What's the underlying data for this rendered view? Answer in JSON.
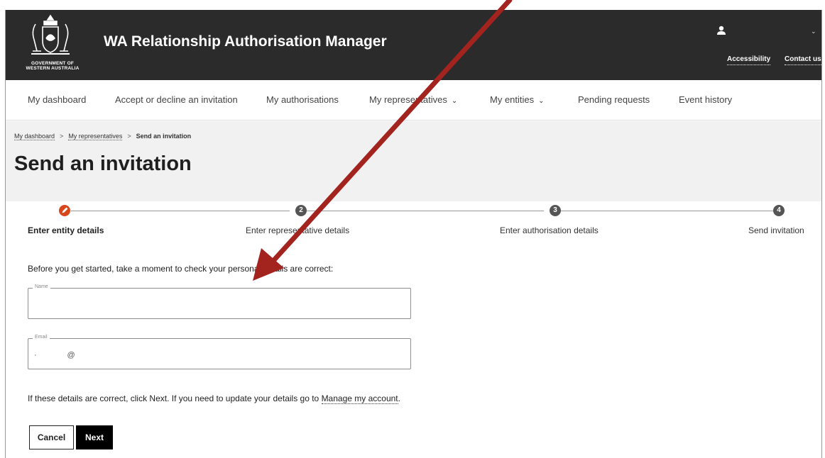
{
  "header": {
    "crest_text_line1": "GOVERNMENT OF",
    "crest_text_line2": "WESTERN AUSTRALIA",
    "app_title": "WA Relationship Authorisation Manager",
    "accessibility_link": "Accessibility",
    "contact_link": "Contact us"
  },
  "nav": {
    "items": [
      {
        "label": "My dashboard"
      },
      {
        "label": "Accept or decline an invitation"
      },
      {
        "label": "My authorisations"
      },
      {
        "label": "My representatives"
      },
      {
        "label": "My entities"
      },
      {
        "label": "Pending requests"
      },
      {
        "label": "Event history"
      }
    ]
  },
  "breadcrumb": {
    "item1": "My dashboard",
    "item2": "My representatives",
    "current": "Send an invitation",
    "separator": ">"
  },
  "page": {
    "title": "Send an invitation"
  },
  "stepper": {
    "steps": [
      {
        "number": "",
        "label": "Enter entity details",
        "state": "active"
      },
      {
        "number": "2",
        "label": "Enter representative details",
        "state": "pending"
      },
      {
        "number": "3",
        "label": "Enter authorisation details",
        "state": "pending"
      },
      {
        "number": "4",
        "label": "Send invitation",
        "state": "pending"
      }
    ]
  },
  "form": {
    "intro": "Before you get started, take a moment to check your personal details are correct:",
    "name_label": "Name",
    "name_value": "",
    "email_label": "Email",
    "email_value": "·              @",
    "hint_prefix": "If these details are correct, click Next. If you need to update your details go to ",
    "hint_link": "Manage my account",
    "hint_suffix": ".",
    "cancel_label": "Cancel",
    "next_label": "Next"
  },
  "colors": {
    "header_bg": "#2b2b2b",
    "active_step": "#d8461b",
    "annotation_arrow": "#a3231f"
  },
  "icons": {
    "user": "user-icon",
    "caret": "chevron-down-icon",
    "active_step": "pencil-icon"
  }
}
